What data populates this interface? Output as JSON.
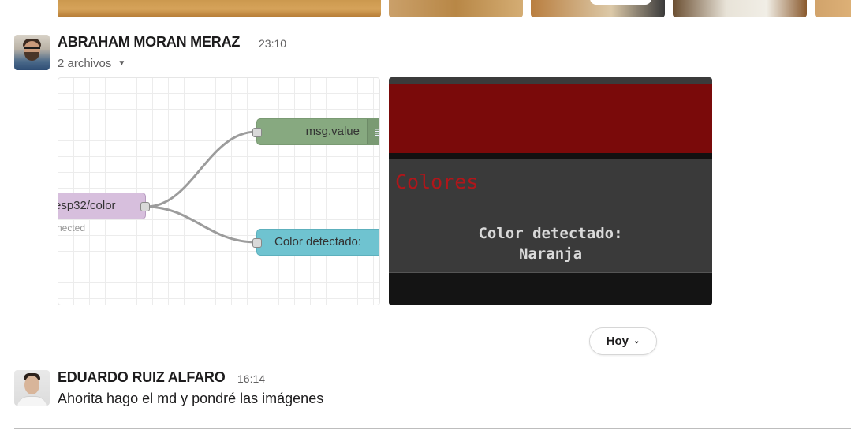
{
  "top_thumbnails": [
    "thumb-1",
    "thumb-2",
    "thumb-3",
    "thumb-4",
    "thumb-5"
  ],
  "messages": [
    {
      "author": "ABRAHAM MORAN MERAZ",
      "time": "23:10",
      "attachments_label": "2 archivos",
      "flow": {
        "node_value": "msg.value",
        "node_input": "esp32/color",
        "node_status": "nected",
        "node_output": "Color detectado:"
      },
      "dashboard": {
        "title": "Colores",
        "label_line1": "Color detectado:",
        "label_line2": "Naranja"
      }
    },
    {
      "author": "EDUARDO RUIZ ALFARO",
      "time": "16:14",
      "text": "Ahorita hago el md y pondré las imágenes"
    }
  ],
  "date_divider": {
    "label": "Hoy"
  },
  "colors": {
    "divider": "#d3b1dd",
    "dashboard_red": "#7a0a0a",
    "dashboard_title": "#b0161a",
    "node_green": "#87a980",
    "node_purple": "#d7bfdd",
    "node_teal": "#6fc3d0"
  }
}
